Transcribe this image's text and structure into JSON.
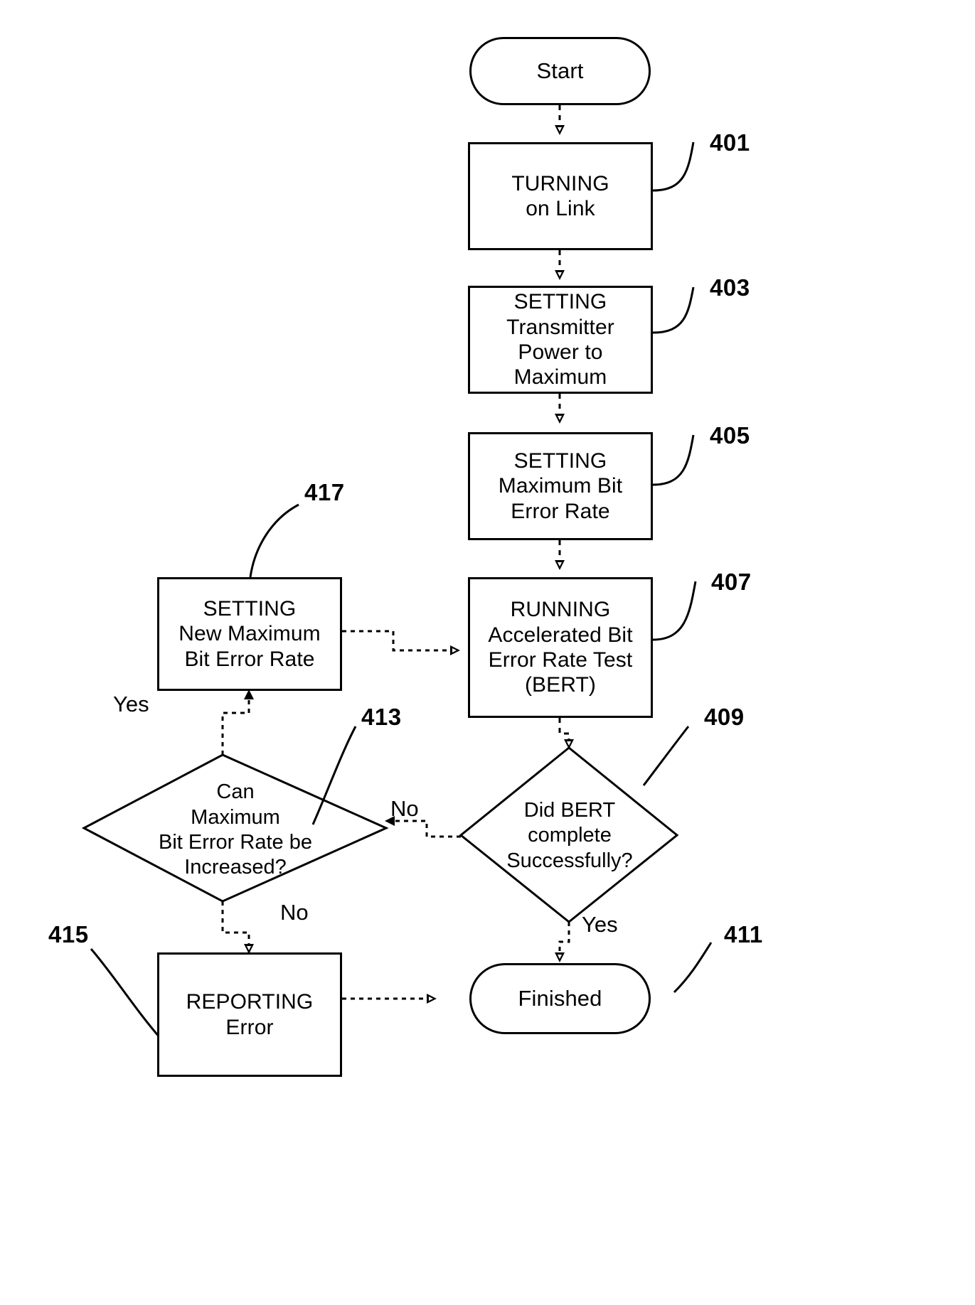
{
  "figure": {
    "type": "flowchart",
    "title": "Accelerated Bit Error Rate Test (BERT) procedure flowchart",
    "style": "patent-drawing",
    "line_color": "#000000",
    "background_color": "#ffffff"
  },
  "nodes": {
    "start": {
      "label": "Start",
      "shape": "terminator",
      "ref": ""
    },
    "turning_on_link": {
      "label": "TURNING\non Link",
      "shape": "process",
      "ref": "401"
    },
    "setting_transmitter_power": {
      "label": "SETTING\nTransmitter\nPower to\nMaximum",
      "shape": "process",
      "ref": "403"
    },
    "setting_max_ber": {
      "label": "SETTING\nMaximum Bit\nError Rate",
      "shape": "process",
      "ref": "405"
    },
    "running_bert": {
      "label": "RUNNING\nAccelerated Bit\nError Rate Test\n(BERT)",
      "shape": "process",
      "ref": "407"
    },
    "did_bert_complete": {
      "label": "Did BERT\ncomplete\nSuccessfully?",
      "shape": "decision",
      "ref": "409"
    },
    "finished": {
      "label": "Finished",
      "shape": "terminator",
      "ref": "411"
    },
    "can_max_ber_increase": {
      "label": "Can\nMaximum\nBit Error Rate be\nIncreased?",
      "shape": "decision",
      "ref": "413"
    },
    "reporting_error": {
      "label": "REPORTING\nError",
      "shape": "process",
      "ref": "415"
    },
    "setting_new_max_ber": {
      "label": "SETTING\nNew Maximum\nBit Error Rate",
      "shape": "process",
      "ref": "417"
    }
  },
  "ref_numbers": {
    "n401": "401",
    "n403": "403",
    "n405": "405",
    "n407": "407",
    "n409": "409",
    "n411": "411",
    "n413": "413",
    "n415": "415",
    "n417": "417"
  },
  "edge_labels": {
    "bert_no": "No",
    "bert_yes": "Yes",
    "can_increase_yes": "Yes",
    "can_increase_no": "No"
  },
  "edges": [
    {
      "from": "start",
      "to": "turning_on_link",
      "label": ""
    },
    {
      "from": "turning_on_link",
      "to": "setting_transmitter_power",
      "label": ""
    },
    {
      "from": "setting_transmitter_power",
      "to": "setting_max_ber",
      "label": ""
    },
    {
      "from": "setting_max_ber",
      "to": "running_bert",
      "label": ""
    },
    {
      "from": "running_bert",
      "to": "did_bert_complete",
      "label": ""
    },
    {
      "from": "did_bert_complete",
      "to": "can_max_ber_increase",
      "label": "No"
    },
    {
      "from": "did_bert_complete",
      "to": "finished",
      "label": "Yes"
    },
    {
      "from": "can_max_ber_increase",
      "to": "setting_new_max_ber",
      "label": "Yes"
    },
    {
      "from": "can_max_ber_increase",
      "to": "reporting_error",
      "label": "No"
    },
    {
      "from": "setting_new_max_ber",
      "to": "running_bert",
      "label": ""
    },
    {
      "from": "reporting_error",
      "to": "finished",
      "label": ""
    }
  ]
}
